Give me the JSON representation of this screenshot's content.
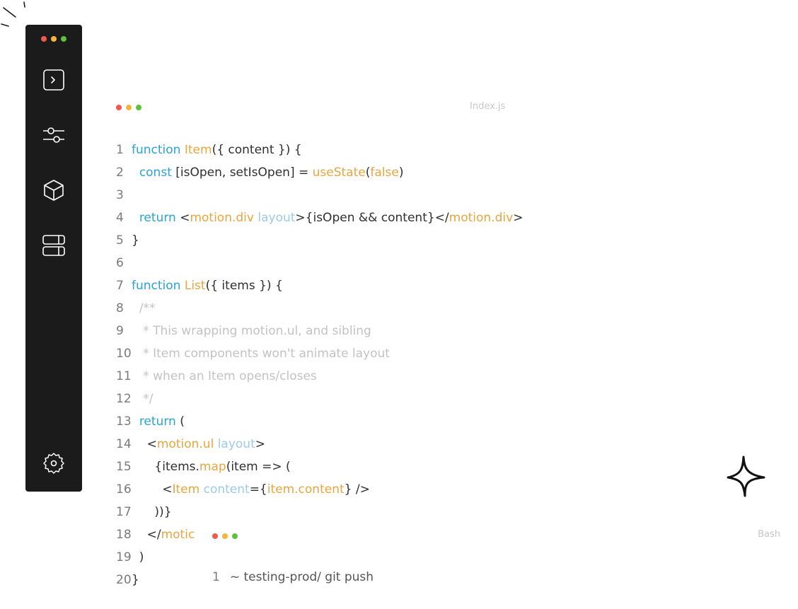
{
  "sidebar": {
    "items": [
      {
        "icon": "terminal-icon"
      },
      {
        "icon": "sliders-icon"
      },
      {
        "icon": "cube-icon"
      },
      {
        "icon": "server-icon"
      }
    ],
    "settings_icon": "gear-icon"
  },
  "colors": {
    "red": "#ef5a4f",
    "yellow": "#f6b53a",
    "green": "#5fbf3f",
    "keyword": "#29a3d6",
    "identifier": "#e9a53f",
    "attribute": "#9ccae8",
    "comment": "#c2c2c2"
  },
  "editor": {
    "filename": "Index.js",
    "lines": [
      {
        "n": "1",
        "segs": [
          {
            "c": "kw",
            "t": "function "
          },
          {
            "c": "fn",
            "t": "Item"
          },
          {
            "c": "",
            "t": "({ content }) {"
          }
        ]
      },
      {
        "n": "2",
        "segs": [
          {
            "c": "",
            "t": "  "
          },
          {
            "c": "kw",
            "t": "const"
          },
          {
            "c": "",
            "t": " [isOpen, setIsOpen] = "
          },
          {
            "c": "fn",
            "t": "useState"
          },
          {
            "c": "",
            "t": "("
          },
          {
            "c": "fn",
            "t": "false"
          },
          {
            "c": "",
            "t": ")"
          }
        ]
      },
      {
        "n": "3",
        "segs": []
      },
      {
        "n": "4",
        "segs": [
          {
            "c": "",
            "t": "  "
          },
          {
            "c": "kw",
            "t": "return"
          },
          {
            "c": "",
            "t": " <"
          },
          {
            "c": "fn",
            "t": "motion.div"
          },
          {
            "c": "",
            "t": " "
          },
          {
            "c": "at",
            "t": "layout"
          },
          {
            "c": "",
            "t": ">{isOpen && content}</"
          },
          {
            "c": "fn",
            "t": "motion.div"
          },
          {
            "c": "",
            "t": ">"
          }
        ]
      },
      {
        "n": "5",
        "segs": [
          {
            "c": "",
            "t": "}"
          }
        ]
      },
      {
        "n": "6",
        "segs": []
      },
      {
        "n": "7",
        "segs": [
          {
            "c": "kw",
            "t": "function "
          },
          {
            "c": "fn",
            "t": "List"
          },
          {
            "c": "",
            "t": "({ items }) {"
          }
        ]
      },
      {
        "n": "8",
        "segs": [
          {
            "c": "cm",
            "t": "  /**"
          }
        ]
      },
      {
        "n": "9",
        "segs": [
          {
            "c": "cm",
            "t": "   * This wrapping motion.ul, and sibling"
          }
        ]
      },
      {
        "n": "10",
        "segs": [
          {
            "c": "cm",
            "t": "   * Item components won't animate layout"
          }
        ]
      },
      {
        "n": "11",
        "segs": [
          {
            "c": "cm",
            "t": "   * when an Item opens/closes"
          }
        ]
      },
      {
        "n": "12",
        "segs": [
          {
            "c": "cm",
            "t": "   */"
          }
        ]
      },
      {
        "n": "13",
        "segs": [
          {
            "c": "",
            "t": "  "
          },
          {
            "c": "kw",
            "t": "return"
          },
          {
            "c": "",
            "t": " ("
          }
        ]
      },
      {
        "n": "14",
        "segs": [
          {
            "c": "",
            "t": "    <"
          },
          {
            "c": "fn",
            "t": "motion.ul"
          },
          {
            "c": "",
            "t": " "
          },
          {
            "c": "at",
            "t": "layout"
          },
          {
            "c": "",
            "t": ">"
          }
        ]
      },
      {
        "n": "15",
        "segs": [
          {
            "c": "",
            "t": "      {items."
          },
          {
            "c": "fn",
            "t": "map"
          },
          {
            "c": "",
            "t": "(item => ("
          }
        ]
      },
      {
        "n": "16",
        "segs": [
          {
            "c": "",
            "t": "        <"
          },
          {
            "c": "fn",
            "t": "Item"
          },
          {
            "c": "",
            "t": " "
          },
          {
            "c": "at",
            "t": "content"
          },
          {
            "c": "",
            "t": "={"
          },
          {
            "c": "fn",
            "t": "item.content"
          },
          {
            "c": "",
            "t": "} />"
          }
        ]
      },
      {
        "n": "17",
        "segs": [
          {
            "c": "",
            "t": "      ))}"
          }
        ]
      },
      {
        "n": "18",
        "segs": [
          {
            "c": "",
            "t": "    </"
          },
          {
            "c": "fn",
            "t": "motic"
          }
        ]
      },
      {
        "n": "19",
        "segs": [
          {
            "c": "",
            "t": "  )"
          }
        ]
      },
      {
        "n": "20",
        "segs": [
          {
            "c": "",
            "t": "}"
          }
        ]
      }
    ]
  },
  "terminal": {
    "title": "Bash",
    "line_number": "1",
    "command": "~ testing-prod/ git push"
  }
}
